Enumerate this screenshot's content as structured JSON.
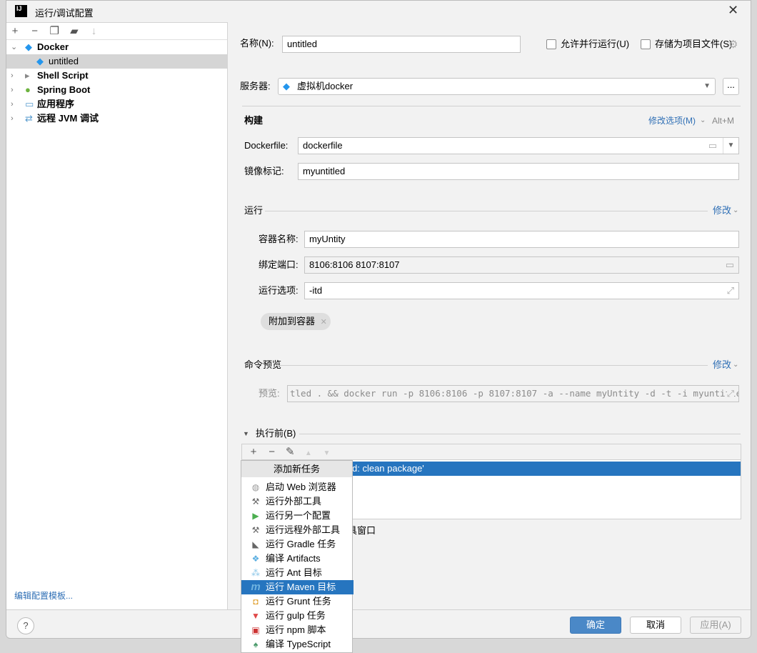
{
  "window": {
    "title": "运行/调试配置",
    "app_icon_text": "IJ"
  },
  "left_toolbar": [
    "add-icon",
    "remove-icon",
    "copy-icon",
    "new-folder-icon",
    "sort-icon"
  ],
  "tree": [
    {
      "label": "Docker",
      "bold": true,
      "expanded": true,
      "icon": "docker-icon"
    },
    {
      "label": "untitled",
      "bold": false,
      "selected": true,
      "icon": "docker-icon"
    },
    {
      "label": "Shell Script",
      "bold": true,
      "icon": "shell-icon"
    },
    {
      "label": "Spring Boot",
      "bold": true,
      "icon": "spring-boot-icon"
    },
    {
      "label": "应用程序",
      "bold": true,
      "icon": "application-icon"
    },
    {
      "label": "远程 JVM 调试",
      "bold": true,
      "icon": "remote-jvm-icon"
    }
  ],
  "edit_templates_link": "编辑配置模板...",
  "form": {
    "name_label": "名称(N):",
    "name_value": "untitled",
    "parallel_label": "允许并行运行(U)",
    "parallel_checked": false,
    "store_label": "存储为项目文件(S)",
    "store_checked": false,
    "server_label": "服务器:",
    "server_value": "虚拟机docker",
    "more_button": "...",
    "build_title": "构建",
    "modify_options": "修改选项(M)",
    "modify_shortcut": "Alt+M",
    "dockerfile_label": "Dockerfile:",
    "dockerfile_value": "dockerfile",
    "image_tag_label": "镜像标记:",
    "image_tag_value": "myuntitled",
    "run_title": "运行",
    "run_modify": "修改",
    "container_name_label": "容器名称:",
    "container_name_value": "myUntity",
    "bind_ports_label": "绑定端口:",
    "bind_ports_value": "8106:8106 8107:8107",
    "run_options_label": "运行选项:",
    "run_options_value": "-itd",
    "attach_chip": "附加到容器",
    "cmd_preview_title": "命令预览",
    "cmd_modify": "修改",
    "preview_label": "预览:",
    "preview_value": "tled . && docker run -p 8106:8106 -p 8107:8107 -a --name myUntity -d -t -i myuntitled",
    "before_title": "执行前(B)",
    "before_tasks": [
      "d: clean package'"
    ],
    "hidden_text": "具窗口"
  },
  "popup": {
    "header": "添加新任务",
    "items": [
      {
        "label": "启动 Web 浏览器",
        "icon": "globe-icon"
      },
      {
        "label": "运行外部工具",
        "icon": "tools-icon"
      },
      {
        "label": "运行另一个配置",
        "icon": "play-icon"
      },
      {
        "label": "运行远程外部工具",
        "icon": "tools-icon"
      },
      {
        "label": "运行 Gradle 任务",
        "icon": "gradle-icon"
      },
      {
        "label": "编译 Artifacts",
        "icon": "artifacts-icon"
      },
      {
        "label": "运行 Ant 目标",
        "icon": "ant-icon"
      },
      {
        "label": "运行 Maven 目标",
        "icon": "maven-icon",
        "selected": true
      },
      {
        "label": "运行 Grunt 任务",
        "icon": "grunt-icon"
      },
      {
        "label": "运行 gulp 任务",
        "icon": "gulp-icon"
      },
      {
        "label": "运行 npm 脚本",
        "icon": "npm-icon"
      },
      {
        "label": "编译 TypeScript",
        "icon": "typescript-icon"
      }
    ]
  },
  "footer": {
    "ok": "确定",
    "cancel": "取消",
    "apply": "应用(A)",
    "help": "?"
  },
  "colors": {
    "accent": "#2675bf",
    "ok_button": "#4a88c7",
    "link": "#2f6fb5"
  }
}
